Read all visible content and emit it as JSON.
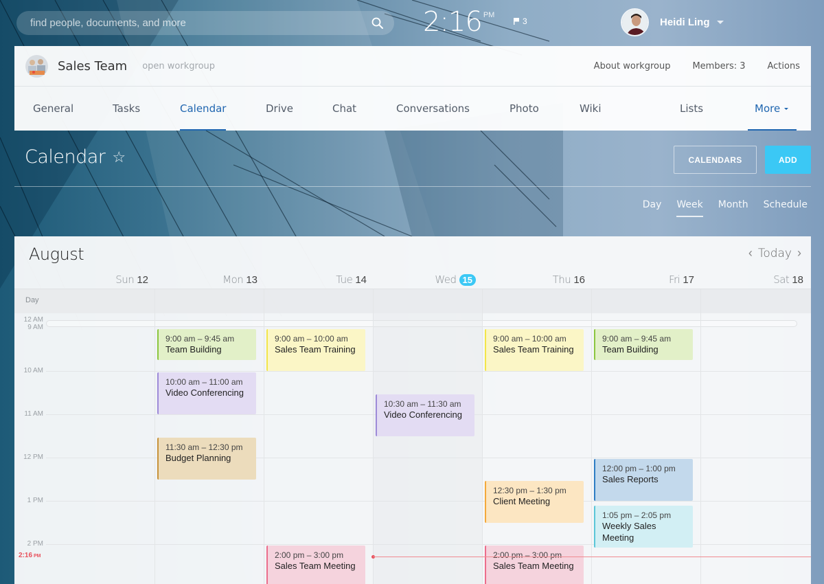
{
  "topbar": {
    "search_placeholder": "find people, documents, and more",
    "search_icon": "search-icon",
    "clock_time": "2:16",
    "clock_ampm": "PM",
    "flag_count": "3",
    "user_name": "Heidi Ling"
  },
  "workgroup": {
    "title": "Sales Team",
    "type": "open workgroup",
    "links": [
      "About workgroup",
      "Members: 3",
      "Actions"
    ],
    "nav": [
      {
        "label": "General",
        "active": false
      },
      {
        "label": "Tasks",
        "active": false
      },
      {
        "label": "Calendar",
        "active": true
      },
      {
        "label": "Drive",
        "active": false
      },
      {
        "label": "Chat",
        "active": false
      },
      {
        "label": "Conversations",
        "active": false
      },
      {
        "label": "Photo",
        "active": false
      },
      {
        "label": "Wiki",
        "active": false
      },
      {
        "label": "Lists",
        "active": false
      },
      {
        "label": "More",
        "active": false
      }
    ]
  },
  "page": {
    "title": "Calendar",
    "calendars_button": "CALENDARS",
    "add_button": "ADD",
    "views": [
      {
        "label": "Day",
        "active": false
      },
      {
        "label": "Week",
        "active": true
      },
      {
        "label": "Month",
        "active": false
      },
      {
        "label": "Schedule",
        "active": false
      }
    ]
  },
  "calendar": {
    "month": "August",
    "today_label": "Today",
    "allday_label": "Day",
    "days": [
      {
        "name": "Sun",
        "num": "12",
        "today": false
      },
      {
        "name": "Mon",
        "num": "13",
        "today": false
      },
      {
        "name": "Tue",
        "num": "14",
        "today": false
      },
      {
        "name": "Wed",
        "num": "15",
        "today": true
      },
      {
        "name": "Thu",
        "num": "16",
        "today": false
      },
      {
        "name": "Fri",
        "num": "17",
        "today": false
      },
      {
        "name": "Sat",
        "num": "18",
        "today": false
      }
    ],
    "hour_labels": [
      "12 AM",
      "9 AM",
      "10 AM",
      "11 AM",
      "12 PM",
      "1 PM",
      "2 PM"
    ],
    "now_label": "2:16",
    "now_ampm": "PM",
    "now_hour": 14.2667,
    "colors": {
      "green": {
        "bg": "#e2f0c8",
        "border": "#8cc63f"
      },
      "yellow": {
        "bg": "#fbf6c6",
        "border": "#f2e64a"
      },
      "purple": {
        "bg": "#e3dcf3",
        "border": "#9d8ad8"
      },
      "tan": {
        "bg": "#ecdcbc",
        "border": "#c7923a"
      },
      "orange": {
        "bg": "#fce6c2",
        "border": "#f3a93b"
      },
      "blue": {
        "bg": "#c3d9ec",
        "border": "#2e7dc4"
      },
      "cyan": {
        "bg": "#d2eff4",
        "border": "#5ac6d8"
      },
      "pink": {
        "bg": "#f5d3dd",
        "border": "#ec6d8c"
      }
    },
    "events": [
      {
        "day": 1,
        "start": 9.0,
        "end": 9.75,
        "time": "9:00 am – 9:45 am",
        "title": "Team Building",
        "color": "green"
      },
      {
        "day": 1,
        "start": 10.0,
        "end": 11.0,
        "time": "10:00 am – 11:00 am",
        "title": "Video Conferencing",
        "color": "purple"
      },
      {
        "day": 1,
        "start": 11.5,
        "end": 12.5,
        "time": "11:30 am – 12:30 pm",
        "title": "Budget Planning",
        "color": "tan"
      },
      {
        "day": 2,
        "start": 9.0,
        "end": 10.0,
        "time": "9:00 am – 10:00 am",
        "title": "Sales Team Training",
        "color": "yellow"
      },
      {
        "day": 2,
        "start": 14.0,
        "end": 15.0,
        "time": "2:00 pm – 3:00 pm",
        "title": "Sales Team Meeting",
        "color": "pink"
      },
      {
        "day": 3,
        "start": 10.5,
        "end": 11.5,
        "time": "10:30 am – 11:30 am",
        "title": "Video Conferencing",
        "color": "purple"
      },
      {
        "day": 4,
        "start": 9.0,
        "end": 10.0,
        "time": "9:00 am – 10:00 am",
        "title": "Sales Team Training",
        "color": "yellow"
      },
      {
        "day": 4,
        "start": 12.5,
        "end": 13.5,
        "time": "12:30 pm – 1:30 pm",
        "title": "Client Meeting",
        "color": "orange"
      },
      {
        "day": 4,
        "start": 14.0,
        "end": 15.0,
        "time": "2:00 pm – 3:00 pm",
        "title": "Sales Team Meeting",
        "color": "pink"
      },
      {
        "day": 5,
        "start": 9.0,
        "end": 9.75,
        "time": "9:00 am – 9:45 am",
        "title": "Team Building",
        "color": "green"
      },
      {
        "day": 5,
        "start": 12.0,
        "end": 13.0,
        "time": "12:00 pm – 1:00 pm",
        "title": "Sales Reports",
        "color": "blue"
      },
      {
        "day": 5,
        "start": 13.0833,
        "end": 14.0833,
        "time": "1:05 pm – 2:05 pm",
        "title": "Weekly Sales Meeting",
        "color": "cyan"
      }
    ]
  }
}
